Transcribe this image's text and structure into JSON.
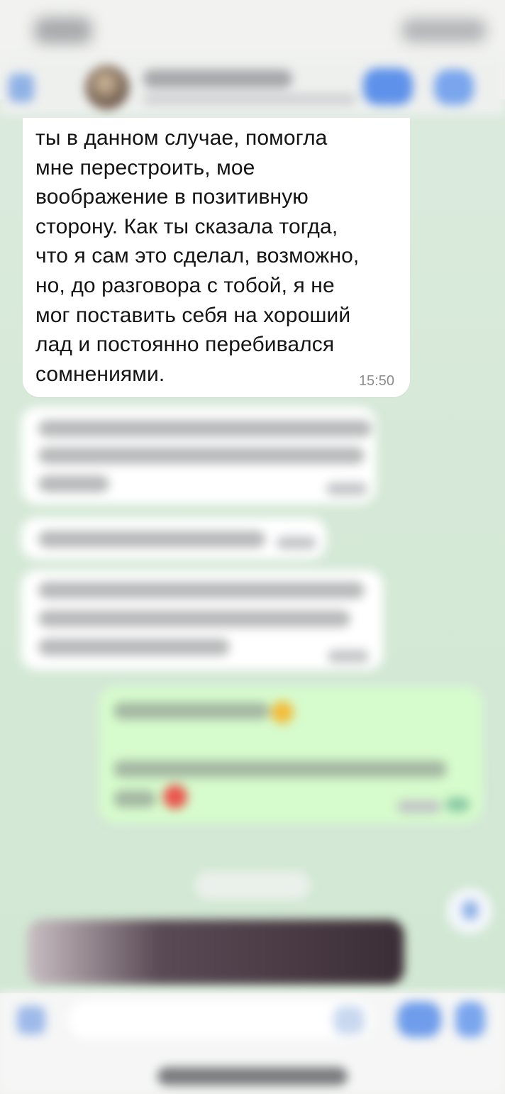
{
  "colors": {
    "accent": "#5e92ea",
    "chat_background": "#d6e9d8",
    "incoming_bubble": "#ffffff",
    "outgoing_bubble": "#d6fbcc"
  },
  "icons": {
    "back": "chevron-left-icon",
    "video": "video-camera-icon",
    "call": "phone-icon",
    "attach": "plus-icon",
    "sticker": "sticker-icon",
    "camera": "camera-icon",
    "mic": "microphone-icon"
  },
  "message": {
    "text": "ты в данном случае, помогла\nмне перестроить, мое\nвоображение в позитивную\nсторону. Как ты сказала тогда,\nчто я сам это сделал, возможно,\nно, до разговора с тобой, я не\nмог поставить себя на хороший\nлад и постоянно перебивался\nсомнениями.",
    "time": "15:50"
  }
}
